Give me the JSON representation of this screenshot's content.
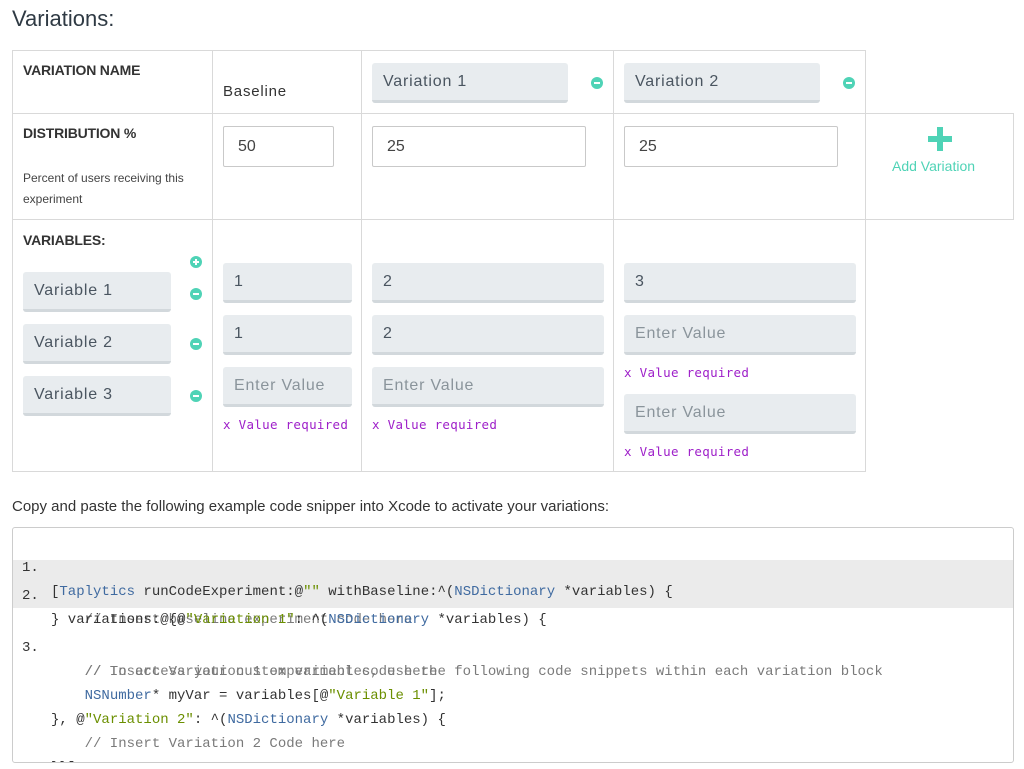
{
  "page": {
    "title": "Variations:"
  },
  "headers": {
    "variation_name": "VARIATION NAME",
    "distribution": "DISTRIBUTION %",
    "distribution_desc_line1": "Percent of users receiving this",
    "distribution_desc_line2": "experiment",
    "variables": "VARIABLES:"
  },
  "variations": {
    "baseline": "Baseline",
    "v1_name": "Variation 1",
    "v2_name": "Variation 2",
    "add_label": "Add Variation"
  },
  "distribution": {
    "baseline": "50",
    "v1": "25",
    "v2": "25"
  },
  "variables": {
    "names": [
      "Variable 1",
      "Variable 2",
      "Variable 3"
    ],
    "baseline": [
      "1",
      "1",
      ""
    ],
    "v1": [
      "2",
      "2",
      ""
    ],
    "v2": [
      "3",
      "",
      ""
    ]
  },
  "placeholders": {
    "enter_value": "Enter Value"
  },
  "errors": {
    "value_required": "x Value required"
  },
  "instructions": "Copy and paste the following example code snipper into Xcode to activate your variations:",
  "code": {
    "line_numbers": [
      "1.",
      "2.",
      "3."
    ],
    "l1_a": "[",
    "l1_b": "Taplytics",
    "l1_c": " runCodeExperiment:@",
    "l1_d": "\"\"",
    "l1_e": " withBaseline:^(",
    "l1_f": "NSDictionary",
    "l1_g": " *variables) {",
    "l2": "    // Insert baseline experiment code here",
    "l3_a": "} variations:@{@",
    "l3_b": "\"Variation 1\"",
    "l3_c": ": ^(",
    "l3_d": "NSDictionary",
    "l3_e": " *variables) {",
    "l4": "    // Insert Variation 1 experiment code here",
    "l5": "    // To access your custom variables, use the following code snippets within each variation block",
    "l6_a": "    ",
    "l6_b": "NSNumber",
    "l6_c": "* myVar = variables[@",
    "l6_d": "\"Variable 1\"",
    "l6_e": "];",
    "l7_a": "}, @",
    "l7_b": "\"Variation 2\"",
    "l7_c": ": ^(",
    "l7_d": "NSDictionary",
    "l7_e": " *variables) {",
    "l8": "    // Insert Variation 2 Code here",
    "l9": "}}];"
  },
  "colors": {
    "accent": "#4fd3b6",
    "error": "#9e1fc9",
    "keyword": "#3f6aa0",
    "string": "#6b8f00"
  }
}
